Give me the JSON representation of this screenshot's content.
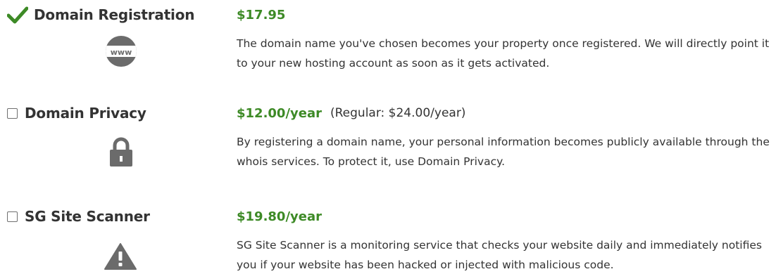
{
  "extras": {
    "domain_registration": {
      "title": "Domain Registration",
      "status_icon": "checkmark-icon",
      "icon": "www-globe-icon",
      "price": "$17.95",
      "description": "The domain name you've chosen becomes your property once registered. We will directly point it to your new hosting account as soon as it gets activated."
    },
    "domain_privacy": {
      "title": "Domain Privacy",
      "icon": "lock-icon",
      "price": "$12.00/year",
      "regular": "(Regular: $24.00/year)",
      "description": "By registering a domain name, your personal information becomes publicly available through the whois services. To protect it, use Domain Privacy."
    },
    "site_scanner": {
      "title": "SG Site Scanner",
      "icon": "warning-icon",
      "price": "$19.80/year",
      "description": "SG Site Scanner is a monitoring service that checks your website daily and immediately notifies you if your website has been hacked or injected with malicious code."
    }
  },
  "colors": {
    "price_green": "#3d8a26",
    "text": "#333333",
    "icon_gray": "#6b6b6b"
  }
}
